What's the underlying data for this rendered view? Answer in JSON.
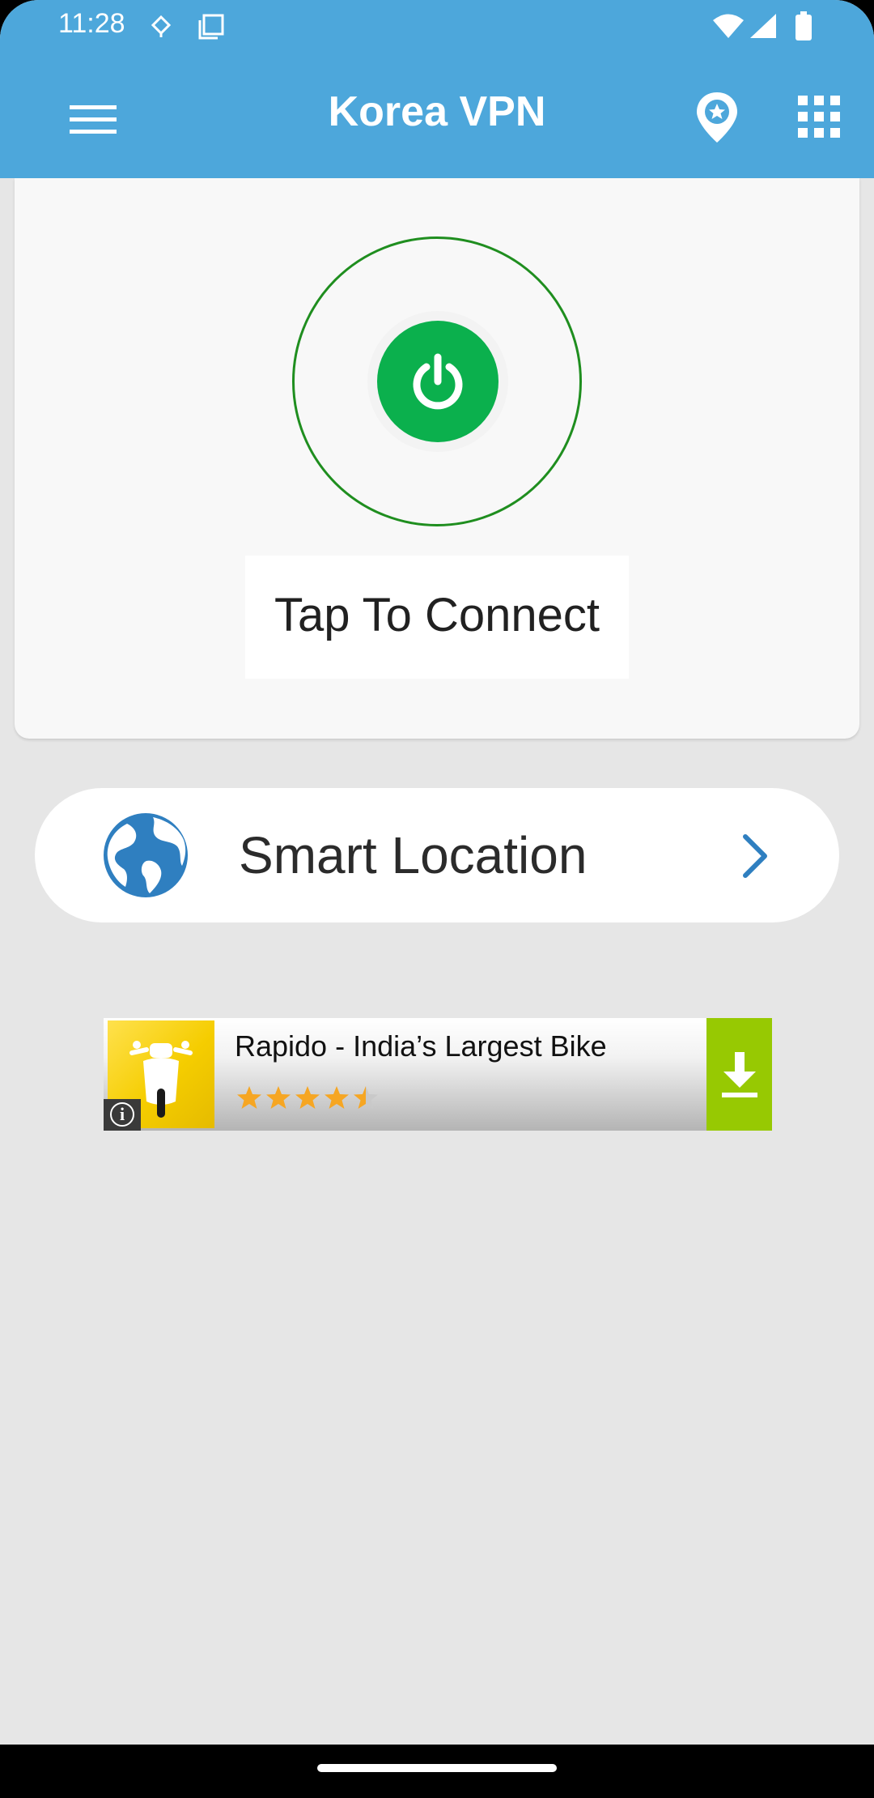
{
  "status_bar": {
    "time": "11:28"
  },
  "toolbar": {
    "title": "Korea VPN",
    "menu_icon": "hamburger-menu-icon",
    "location_icon": "location-pin-star-icon",
    "apps_icon": "apps-grid-icon"
  },
  "connect": {
    "status_text": "Tap To Connect",
    "power_icon": "power-icon",
    "ring_color": "#1f8e1f",
    "button_color": "#0bb04d"
  },
  "location": {
    "label": "Smart Location",
    "globe_icon": "globe-icon",
    "chevron_icon": "chevron-right-icon"
  },
  "ad": {
    "title": "Rapido - India’s Largest Bike",
    "rating": 4.5,
    "rating_max": 5,
    "info_icon": "info-icon",
    "download_icon": "download-icon"
  },
  "colors": {
    "app_bar": "#4da7db",
    "background": "#e6e6e6",
    "accent_blue": "#2f7fc0",
    "ad_download": "#97c902",
    "star": "#f6a623"
  }
}
